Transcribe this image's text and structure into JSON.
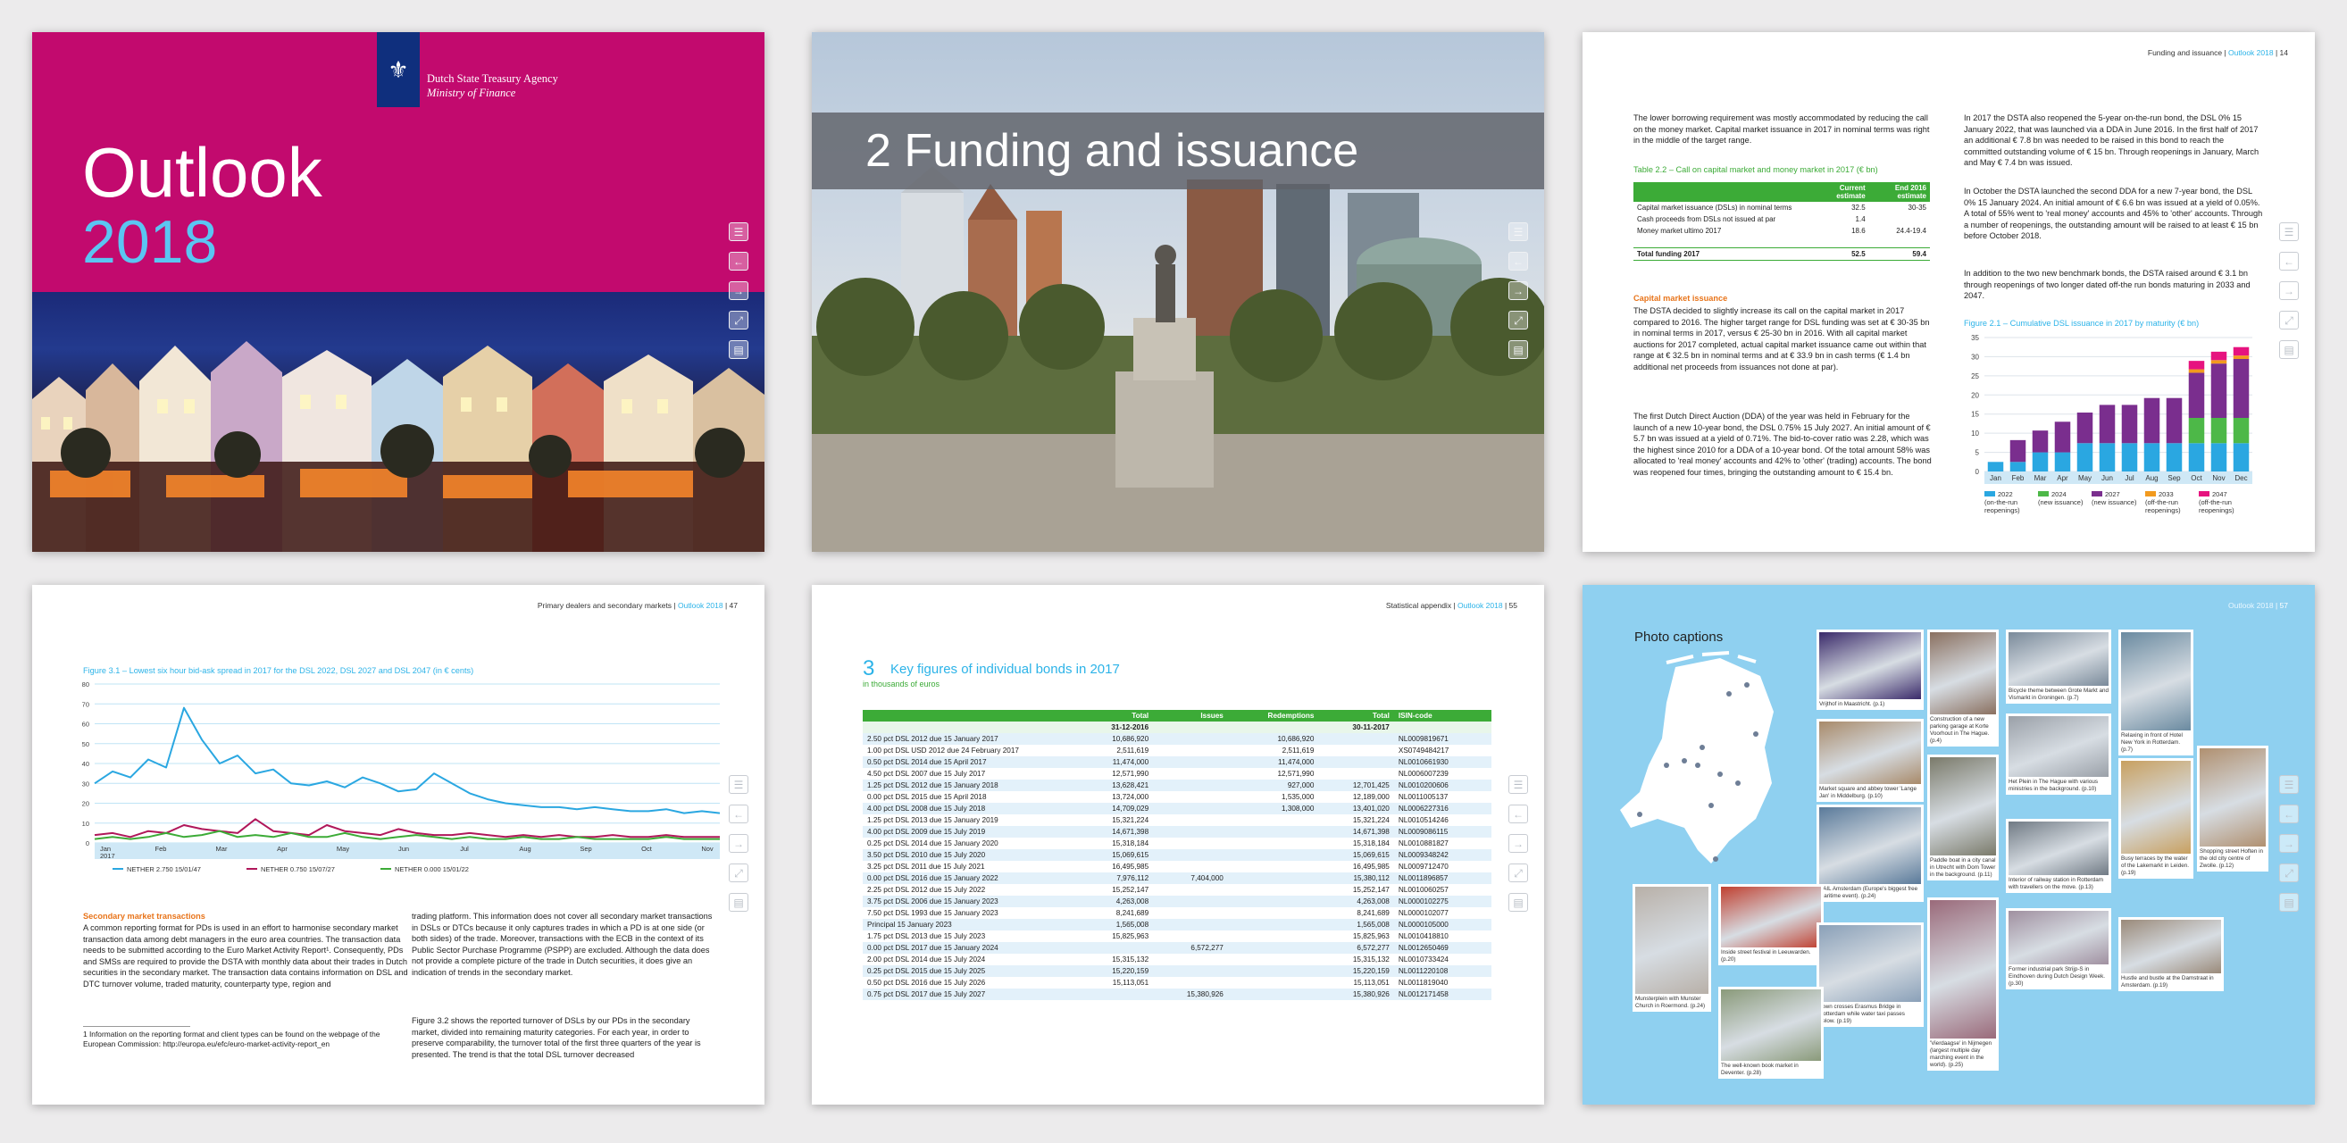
{
  "cover": {
    "agency_line1": "Dutch State Treasury Agency",
    "agency_line2": "Ministry of Finance",
    "title": "Outlook",
    "year": "2018"
  },
  "funding": {
    "chapter_title": "2 Funding and issuance"
  },
  "page14": {
    "header_section": "Funding and issuance |",
    "header_outlook": "Outlook 2018",
    "header_page": "| 14",
    "intro": "The lower borrowing requirement was mostly accommodated by reducing the call on the money market. Capital market issuance in 2017 in nominal terms was right in the middle of the target range.",
    "table_caption": "Table 2.2 – Call on capital market and money market in 2017 (€ bn)",
    "table_head": [
      "",
      "Current estimate",
      "End 2016 estimate"
    ],
    "table_rows": [
      [
        "Capital market issuance (DSLs) in nominal terms",
        "32.5",
        "30-35"
      ],
      [
        "Cash proceeds from DSLs not issued at par",
        "1.4",
        ""
      ],
      [
        "Money market ultimo 2017",
        "18.6",
        "24.4-19.4"
      ]
    ],
    "table_total": [
      "Total funding 2017",
      "52.5",
      "59.4"
    ],
    "sub_capital": "Capital market issuance",
    "para1": "The DSTA decided to slightly increase its call on the capital market in 2017 compared to 2016. The higher target range for DSL funding was set at € 30-35 bn in nominal terms in 2017, versus € 25-30 bn in 2016. With all capital market auctions for 2017 completed, actual capital market issuance came out within that range at € 32.5 bn in nominal terms and at € 33.9 bn in cash terms (€ 1.4 bn additional net proceeds from issuances not done at par).",
    "para2": "The first Dutch Direct Auction (DDA) of the year was held in February for the launch of a new 10-year bond, the DSL 0.75% 15 July 2027. An initial amount of € 5.7 bn was issued at a yield of 0.71%. The bid-to-cover ratio was 2.28, which was the highest since 2010 for a DDA of a 10-year bond. Of the total amount 58% was allocated to 'real money' accounts and 42% to 'other' (trading) accounts. The bond was reopened four times, bringing the outstanding amount to € 15.4 bn.",
    "para3": "In 2017 the DSTA also reopened the 5-year on-the-run bond, the DSL 0% 15 January 2022, that was launched via a DDA in June 2016. In the first half of 2017 an additional € 7.8 bn was needed to be raised in this bond to reach the committed outstanding volume of € 15 bn. Through reopenings in January, March and May € 7.4 bn was issued.",
    "para4": "In October the DSTA launched the second DDA for a new 7-year bond, the DSL 0% 15 January 2024. An initial amount of € 6.6 bn was issued at a yield of 0.05%. A total of 55% went to 'real money' accounts and 45% to 'other' accounts. Through a number of reopenings, the outstanding amount will be raised to at least € 15 bn before October 2018.",
    "para5": "In addition to the two new benchmark bonds, the DSTA raised around € 3.1 bn through reopenings of two longer dated off-the run bonds maturing in 2033 and 2047.",
    "figure_caption": "Figure 2.1 – Cumulative DSL issuance in 2017 by maturity (€ bn)"
  },
  "chart_data": [
    {
      "type": "bar",
      "title": "Figure 2.1 – Cumulative DSL issuance in 2017 by maturity (€ bn)",
      "categories": [
        "Jan",
        "Feb",
        "Mar",
        "Apr",
        "May",
        "Jun",
        "Jul",
        "Aug",
        "Sep",
        "Oct",
        "Nov",
        "Dec"
      ],
      "ylim": [
        0,
        35
      ],
      "yticks": [
        0,
        5,
        10,
        15,
        20,
        25,
        30,
        35
      ],
      "legend_position": "bottom",
      "series": [
        {
          "name": "2022 (on-the-run reopenings)",
          "color": "#2aa7e1",
          "values": [
            2.5,
            2.5,
            5.0,
            5.0,
            7.4,
            7.4,
            7.4,
            7.4,
            7.4,
            7.4,
            7.4,
            7.4
          ]
        },
        {
          "name": "2024 (new issuance)",
          "color": "#4db848",
          "values": [
            0,
            0,
            0,
            0,
            0,
            0,
            0,
            0,
            0,
            6.6,
            6.6,
            6.6
          ]
        },
        {
          "name": "2027 (new issuance)",
          "color": "#7a2e8e",
          "values": [
            0,
            5.7,
            5.7,
            8.0,
            8.0,
            10.0,
            10.0,
            11.8,
            11.8,
            11.8,
            14.2,
            15.4
          ]
        },
        {
          "name": "2033 (off-the-run reopenings)",
          "color": "#f29a1e",
          "values": [
            0,
            0,
            0,
            0,
            0,
            0,
            0,
            0,
            0,
            0.9,
            0.9,
            0.9
          ]
        },
        {
          "name": "2047 (off-the-run reopenings)",
          "color": "#e6137f",
          "values": [
            0,
            0,
            0,
            0,
            0,
            0,
            0,
            0,
            0,
            2.2,
            2.2,
            2.2
          ]
        }
      ]
    },
    {
      "type": "line",
      "title": "Figure 3.1 – Lowest six hour bid-ask spread in 2017 for the DSL 2022, DSL 2027 and DSL 2047 (in € cents)",
      "x_ticks": [
        "Jan 2017",
        "Feb",
        "Mar",
        "Apr",
        "May",
        "Jun",
        "Jul",
        "Aug",
        "Sep",
        "Oct",
        "Nov"
      ],
      "ylim": [
        0,
        80
      ],
      "yticks": [
        0,
        10,
        20,
        30,
        40,
        50,
        60,
        70,
        80
      ],
      "legend_position": "bottom",
      "series": [
        {
          "name": "NETHER 2.750 15/01/47",
          "color": "#2aa7e1",
          "values": [
            30,
            36,
            33,
            42,
            38,
            68,
            52,
            40,
            44,
            35,
            37,
            30,
            29,
            31,
            28,
            33,
            30,
            26,
            27,
            35,
            30,
            25,
            22,
            20,
            19,
            18,
            18,
            17,
            18,
            17,
            16,
            16,
            17,
            15,
            16,
            15
          ]
        },
        {
          "name": "NETHER 0.750 15/07/27",
          "color": "#b0175a",
          "values": [
            4,
            5,
            3,
            6,
            5,
            9,
            7,
            6,
            5,
            12,
            6,
            5,
            4,
            9,
            6,
            5,
            4,
            7,
            5,
            4,
            4,
            5,
            4,
            3,
            4,
            3,
            4,
            3,
            3,
            4,
            3,
            3,
            4,
            3,
            3,
            3
          ]
        },
        {
          "name": "NETHER 0.000 15/01/22",
          "color": "#3cab37",
          "values": [
            2,
            3,
            2,
            3,
            5,
            3,
            4,
            6,
            3,
            4,
            3,
            5,
            3,
            3,
            5,
            3,
            2,
            3,
            4,
            3,
            2,
            3,
            2,
            2,
            3,
            2,
            2,
            3,
            2,
            2,
            2,
            2,
            3,
            2,
            2,
            2
          ]
        }
      ]
    }
  ],
  "page47": {
    "header_section": "Primary dealers and secondary markets |",
    "header_outlook": "Outlook 2018",
    "header_page": "| 47",
    "figure_caption": "Figure 3.1 – Lowest six hour bid-ask spread in 2017 for the DSL 2022, DSL 2027 and DSL 2047 (in € cents)",
    "x_ticks": [
      "Jan\n2017",
      "Feb",
      "Mar",
      "Apr",
      "May",
      "Jun",
      "Jul",
      "Aug",
      "Sep",
      "Oct",
      "Nov"
    ],
    "sub_secondary": "Secondary market transactions",
    "para1": "A common reporting format for PDs is used in an effort to harmonise secondary market transaction data among debt managers in the euro area countries. The transaction data needs to be submitted according to the Euro Market Activity Report¹. Consequently, PDs and SMSs are required to provide the DSTA with monthly data about their trades in Dutch securities in the secondary market. The transaction data contains information on DSL and DTC turnover volume, traded maturity, counterparty type, region and",
    "footnote": "1   Information on the reporting format and client types can be found on the webpage of the European Commission: http://europa.eu/efc/euro-market-activity-report_en",
    "para2": "trading platform. This information does not cover all secondary market transactions in DSLs or DTCs because it only captures trades in which a PD is at one side (or both sides) of the trade. Moreover, transactions with the ECB in the context of its Public Sector Purchase Programme (PSPP) are excluded. Although the data does not provide a complete picture of the trade in Dutch securities, it does give an indication of trends in the secondary market.",
    "para3": "Figure 3.2 shows the reported turnover of DSLs by our PDs in the secondary market, divided into remaining maturity categories. For each year, in order to preserve comparability, the turnover total of the first three quarters of the year is presented. The trend is that the total DSL turnover decreased"
  },
  "page55": {
    "header_section": "Statistical appendix |",
    "header_outlook": "Outlook 2018",
    "header_page": "| 55",
    "chapter_num": "3",
    "title": "Key figures of individual bonds in 2017",
    "subtitle": "in thousands of euros",
    "head": [
      "",
      "Total",
      "Issues",
      "Redemptions",
      "Total",
      "ISIN-code"
    ],
    "dates": [
      "",
      "31-12-2016",
      "",
      "",
      "30-11-2017",
      ""
    ],
    "rows": [
      [
        "2.50 pct DSL 2012 due 15 January 2017",
        "10,686,920",
        "",
        "10,686,920",
        "",
        "NL0009819671"
      ],
      [
        "1.00 pct DSL USD 2012 due 24 February 2017",
        "2,511,619",
        "",
        "2,511,619",
        "",
        "XS0749484217"
      ],
      [
        "0.50 pct DSL 2014 due 15 April 2017",
        "11,474,000",
        "",
        "11,474,000",
        "",
        "NL0010661930"
      ],
      [
        "4.50 pct DSL 2007 due 15 July 2017",
        "12,571,990",
        "",
        "12,571,990",
        "",
        "NL0006007239"
      ],
      [
        "1.25 pct DSL 2012 due 15 January 2018",
        "13,628,421",
        "",
        "927,000",
        "12,701,425",
        "NL0010200606"
      ],
      [
        "0.00 pct DSL 2015 due 15 April 2018",
        "13,724,000",
        "",
        "1,535,000",
        "12,189,000",
        "NL0011005137"
      ],
      [
        "4.00 pct DSL 2008 due 15 July 2018",
        "14,709,029",
        "",
        "1,308,000",
        "13,401,020",
        "NL0006227316"
      ],
      [
        "1.25 pct DSL 2013 due 15 January 2019",
        "15,321,224",
        "",
        "",
        "15,321,224",
        "NL0010514246"
      ],
      [
        "4.00 pct DSL 2009 due 15 July 2019",
        "14,671,398",
        "",
        "",
        "14,671,398",
        "NL0009086115"
      ],
      [
        "0.25 pct DSL 2014 due 15 January 2020",
        "15,318,184",
        "",
        "",
        "15,318,184",
        "NL0010881827"
      ],
      [
        "3.50 pct DSL 2010 due 15 July 2020",
        "15,069,615",
        "",
        "",
        "15,069,615",
        "NL0009348242"
      ],
      [
        "3.25 pct DSL 2011 due 15 July 2021",
        "16,495,985",
        "",
        "",
        "16,495,985",
        "NL0009712470"
      ],
      [
        "0.00 pct DSL 2016 due 15 January 2022",
        "7,976,112",
        "7,404,000",
        "",
        "15,380,112",
        "NL0011896857"
      ],
      [
        "2.25 pct DSL 2012 due 15 July 2022",
        "15,252,147",
        "",
        "",
        "15,252,147",
        "NL0010060257"
      ],
      [
        "3.75 pct DSL 2006 due 15 January 2023",
        "4,263,008",
        "",
        "",
        "4,263,008",
        "NL0000102275"
      ],
      [
        "7.50 pct DSL 1993 due 15 January 2023",
        "8,241,689",
        "",
        "",
        "8,241,689",
        "NL0000102077"
      ],
      [
        "Principal 15 January 2023",
        "1,565,008",
        "",
        "",
        "1,565,008",
        "NL0000105000"
      ],
      [
        "1.75 pct DSL 2013 due 15 July 2023",
        "15,825,963",
        "",
        "",
        "15,825,963",
        "NL0010418810"
      ],
      [
        "0.00 pct DSL 2017 due 15 January 2024",
        "",
        "6,572,277",
        "",
        "6,572,277",
        "NL0012650469"
      ],
      [
        "2.00 pct DSL 2014 due 15 July 2024",
        "15,315,132",
        "",
        "",
        "15,315,132",
        "NL0010733424"
      ],
      [
        "0.25 pct DSL 2015 due 15 July 2025",
        "15,220,159",
        "",
        "",
        "15,220,159",
        "NL0011220108"
      ],
      [
        "0.50 pct DSL 2016 due 15 July 2026",
        "15,113,051",
        "",
        "",
        "15,113,051",
        "NL0011819040"
      ],
      [
        "0.75 pct DSL 2017 due 15 July 2027",
        "",
        "15,380,926",
        "",
        "15,380,926",
        "NL0012171458"
      ]
    ]
  },
  "page57": {
    "header_outlook": "Outlook 2018",
    "header_page": "| 57",
    "title": "Photo captions",
    "captions": [
      "Vrijthof in Maastricht. (p.1)",
      "Construction of a new parking garage at Korte Voorhout in The Hague. (p.4)",
      "Bicycle theme between Grote Markt and Vismarkt in Groningen. (p.7)",
      "Relaxing in front of Hotel New York in Rotterdam. (p.7)",
      "Market square and abbey tower 'Lange Jan' in Middelburg. (p.10)",
      "Het Plein in The Hague with various ministries in the background. (p.10)",
      "SAIL Amsterdam (Europe's biggest free maritime event). (p.24)",
      "Paddle boat in a city canal in Utrecht with Dom Tower in the background. (p.11)",
      "Busy terraces by the water of the Lakemarkt in Leiden. (p.19)",
      "Shopping street Hoften in the old city centre of Zwolle. (p.12)",
      "Interior of railway station in Rotterdam with travellers on the move. (p.13)",
      "Munsterplein with Munster Church in Roermond. (p.24)",
      "Inside street festival in Leeuwarden. (p.20)",
      "Town crosses Erasmus Bridge in Rotterdam while water taxi passes below. (p.19)",
      "'Vierdaagse' in Nijmegen (largest multiple day marching event in the world). (p.25)",
      "Former industrial park Strijp-S in Eindhoven during Dutch Design Week. (p.30)",
      "Hustle and bustle at the Damstraat in Amsterdam. (p.19)",
      "The well-known book market in Deventer. (p.28)"
    ]
  },
  "rail_icons": [
    "toc-icon",
    "prev-page-icon",
    "next-page-icon",
    "fullscreen-icon",
    "print-icon"
  ],
  "rail_glyphs": [
    "☰",
    "←",
    "→",
    "⤢",
    "▤"
  ]
}
